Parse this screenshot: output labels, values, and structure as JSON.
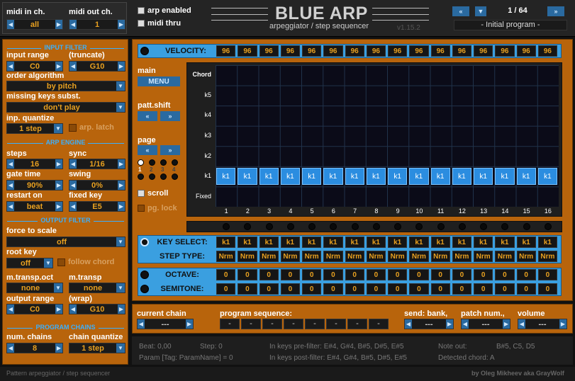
{
  "header": {
    "midi_in_label": "midi in ch.",
    "midi_in_value": "all",
    "midi_out_label": "midi out ch.",
    "midi_out_value": "1",
    "arp_enabled": "arp enabled",
    "midi_thru": "midi thru",
    "title": "BLUE ARP",
    "subtitle": "arpeggiator / step sequencer",
    "version": "v1.15.2",
    "program_counter": "1 / 64",
    "program_name": "- Initial program -"
  },
  "left": {
    "input_filter": "INPUT FILTER",
    "input_range": "input range",
    "truncate": "(truncate)",
    "range_low": "C0",
    "range_high": "G10",
    "order_algorithm": "order algorithm",
    "order_value": "by pitch",
    "missing_keys": "missing keys subst.",
    "missing_value": "don't play",
    "inp_quantize": "inp. quantize",
    "quantize_value": "1 step",
    "arp_latch": "arp. latch",
    "arp_engine": "ARP ENGINE",
    "steps": "steps",
    "steps_value": "16",
    "sync": "sync",
    "sync_value": "1/16",
    "gate_time": "gate time",
    "gate_value": "90%",
    "swing": "swing",
    "swing_value": "0%",
    "restart_on": "restart on",
    "restart_value": "beat",
    "fixed_key": "fixed key",
    "fixed_value": "E5",
    "output_filter": "OUTPUT FILTER",
    "force_scale": "force to scale",
    "force_value": "off",
    "root_key": "root key",
    "root_value": "off",
    "follow_chord": "follow chord",
    "mtransp_oct": "m.transp.oct",
    "mtransp_oct_value": "none",
    "mtransp": "m.transp",
    "mtransp_value": "none",
    "output_range": "output range",
    "wrap": "(wrap)",
    "out_low": "C0",
    "out_high": "G10",
    "program_chains": "PROGRAM CHAINS",
    "num_chains": "num. chains",
    "num_chains_value": "8",
    "chain_quantize": "chain quantize",
    "chain_quantize_value": "1 step"
  },
  "grid": {
    "velocity_label": "VELOCITY:",
    "velocity": [
      "96",
      "96",
      "96",
      "96",
      "96",
      "96",
      "96",
      "96",
      "96",
      "96",
      "96",
      "96",
      "96",
      "96",
      "96",
      "96"
    ],
    "main_label": "main",
    "menu_button": "MENU",
    "patt_shift": "patt.shift",
    "page_label": "page",
    "page_nums": [
      "1",
      "2",
      "3",
      "4"
    ],
    "scroll": "scroll",
    "pg_lock": "pg. lock",
    "y_labels": [
      "Chord",
      "k5",
      "k4",
      "k3",
      "k2",
      "k1",
      "Fixed"
    ],
    "step_key": "k1",
    "step_nums": [
      "1",
      "2",
      "3",
      "4",
      "5",
      "6",
      "7",
      "8",
      "9",
      "10",
      "11",
      "12",
      "13",
      "14",
      "15",
      "16"
    ],
    "key_select_label": "KEY SELECT:",
    "step_type_label": "STEP TYPE:",
    "key_select": [
      "k1",
      "k1",
      "k1",
      "k1",
      "k1",
      "k1",
      "k1",
      "k1",
      "k1",
      "k1",
      "k1",
      "k1",
      "k1",
      "k1",
      "k1",
      "k1"
    ],
    "step_type": [
      "Nrm",
      "Nrm",
      "Nrm",
      "Nrm",
      "Nrm",
      "Nrm",
      "Nrm",
      "Nrm",
      "Nrm",
      "Nrm",
      "Nrm",
      "Nrm",
      "Nrm",
      "Nrm",
      "Nrm",
      "Nrm"
    ],
    "octave_label": "OCTAVE:",
    "semitone_label": "SEMITONE:",
    "octave": [
      "0",
      "0",
      "0",
      "0",
      "0",
      "0",
      "0",
      "0",
      "0",
      "0",
      "0",
      "0",
      "0",
      "0",
      "0",
      "0"
    ],
    "semitone": [
      "0",
      "0",
      "0",
      "0",
      "0",
      "0",
      "0",
      "0",
      "0",
      "0",
      "0",
      "0",
      "0",
      "0",
      "0",
      "0"
    ]
  },
  "bottom": {
    "current_chain": "current chain",
    "chain_value": "---",
    "program_sequence": "program sequence:",
    "sequence": [
      "-",
      "-",
      "-",
      "-",
      "-",
      "-",
      "-",
      "-"
    ],
    "send_bank": "send: bank,",
    "bank_value": "---",
    "patch_num": "patch num.,",
    "patch_value": "---",
    "volume": "volume",
    "volume_value": "---"
  },
  "status": {
    "beat": "Beat: 0,00",
    "step": "Step: 0",
    "pre_filter": "In keys pre-filter: E#4, G#4, B#5, D#5, E#5",
    "note_out": "Note out:",
    "note_out_value": "B#5, C5, D5",
    "param": "Param [Tag: ParamName] = 0",
    "post_filter": "In keys post-filter: E#4, G#4, B#5, D#5, E#5",
    "detected_chord": "Detected chord: A"
  },
  "footer": {
    "left": "Pattern arpeggiator / step sequencer",
    "right": "by Oleg Mikheev aka GrayWolf"
  },
  "colors": {
    "orange": "#b8640c",
    "blue": "#3a9fe0",
    "value": "#e8a020",
    "dark": "#1e1e1e"
  }
}
